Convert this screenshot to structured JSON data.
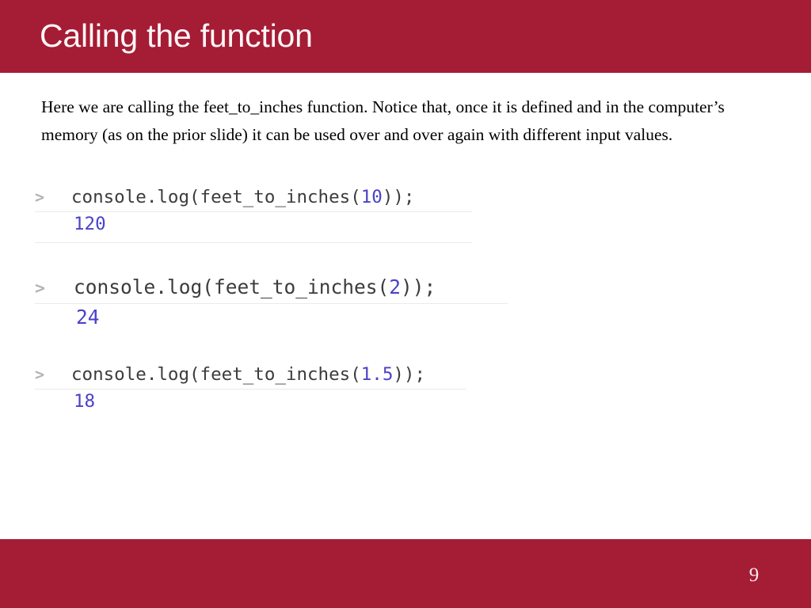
{
  "slide": {
    "title": "Calling the function",
    "page_number": "9",
    "body_text": "Here we are calling the feet_to_inches function.  Notice that, once it is defined and in the computer’s memory (as on the prior slide) it can be used over and over again with different input values.",
    "theme": {
      "bar_color": "#a51c35",
      "title_color": "#fdf6f7",
      "body_color": "#000000",
      "code_color": "#3c3c3c",
      "value_color": "#4a42c8",
      "prompt_color": "#b4b4b4",
      "separator_color": "#eaeaea",
      "background": "#ffffff"
    }
  },
  "console_blocks": [
    {
      "prompt": ">",
      "code_before": "console.log(feet_to_inches(",
      "code_argument": "10",
      "code_after": "));",
      "output": "120"
    },
    {
      "prompt": ">",
      "code_before": "console.log(feet_to_inches(",
      "code_argument": "2",
      "code_after": "));",
      "output": "24"
    },
    {
      "prompt": ">",
      "code_before": "console.log(feet_to_inches(",
      "code_argument": "1.5",
      "code_after": "));",
      "output": "18"
    }
  ]
}
